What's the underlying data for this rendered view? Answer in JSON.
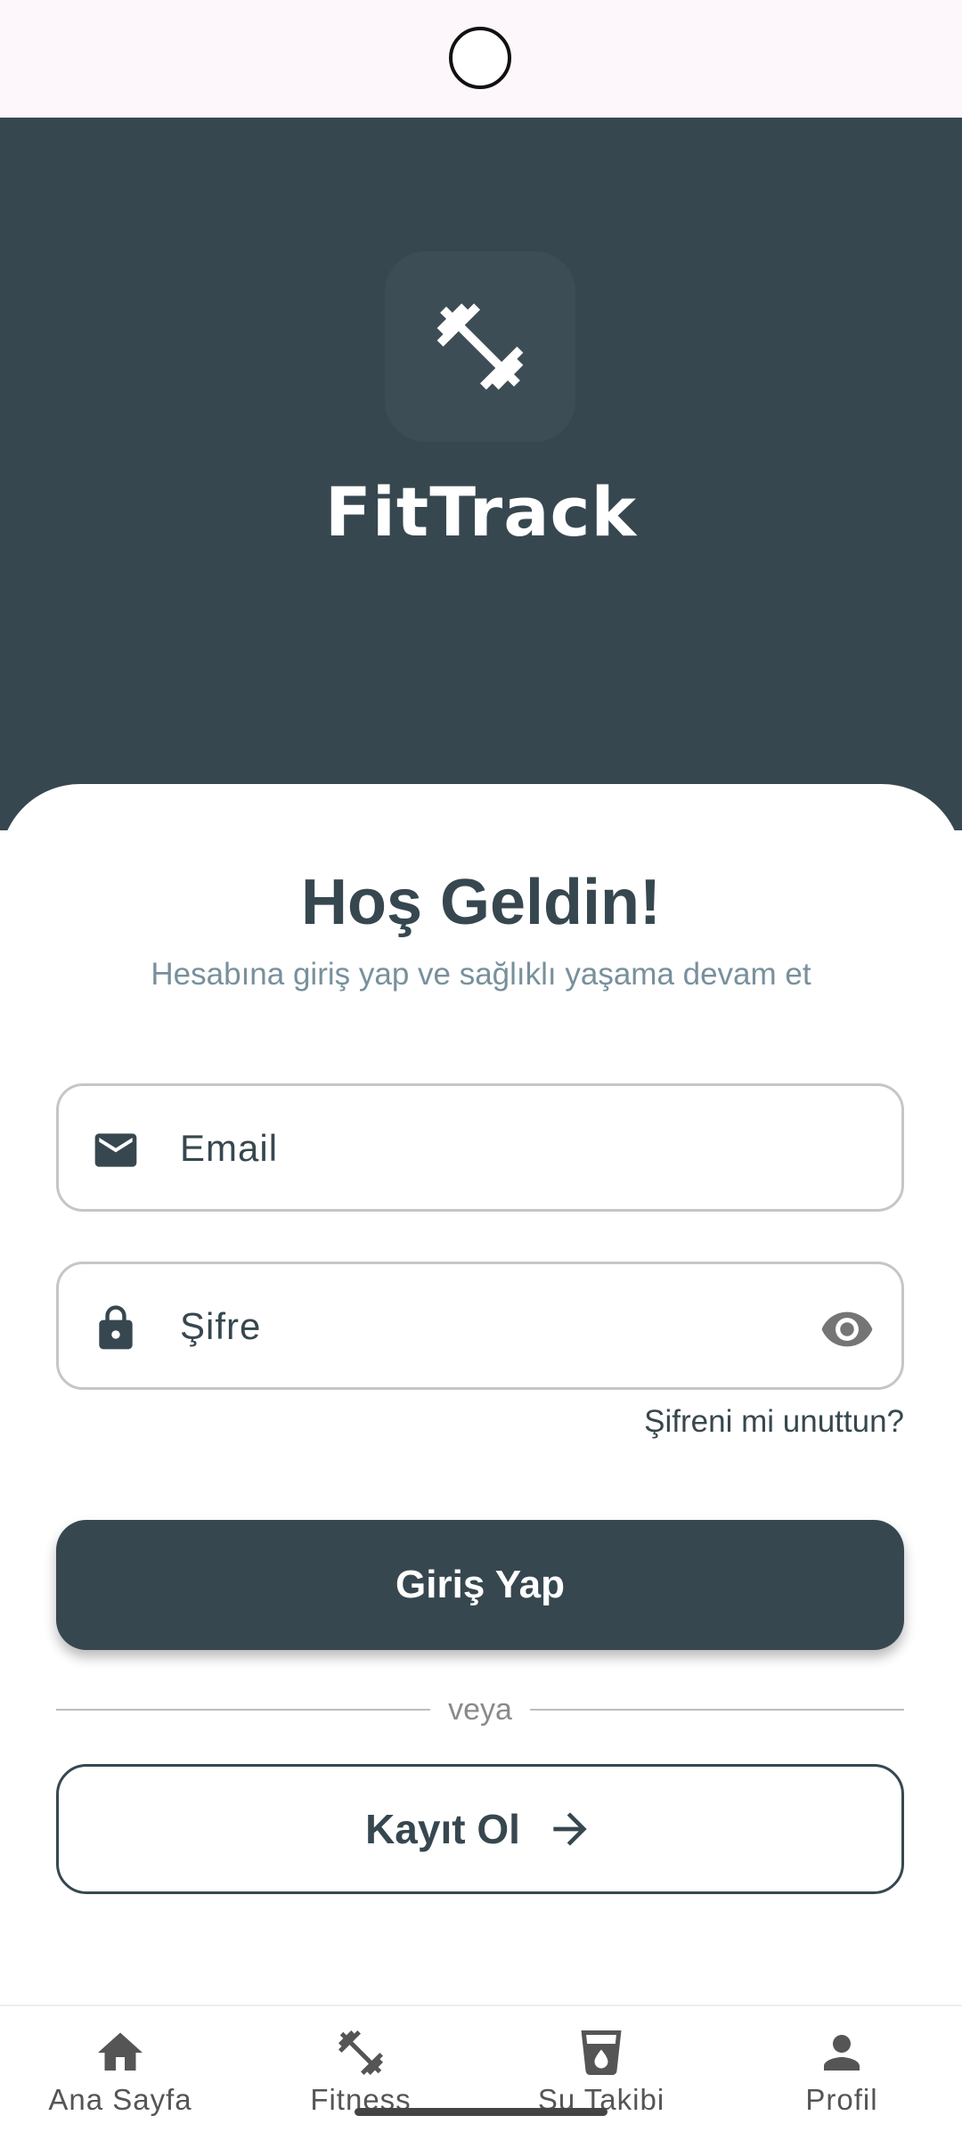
{
  "app": {
    "name": "FitTrack"
  },
  "welcome": {
    "title": "Hoş Geldin!",
    "subtitle": "Hesabına giriş yap ve sağlıklı yaşama devam et"
  },
  "form": {
    "email_placeholder": "Email",
    "password_placeholder": "Şifre",
    "forgot_label": "Şifreni mi unuttun?",
    "login_label": "Giriş Yap",
    "divider_label": "veya",
    "register_label": "Kayıt Ol"
  },
  "nav": {
    "items": [
      {
        "label": "Ana Sayfa",
        "icon": "home-icon"
      },
      {
        "label": "Fitness",
        "icon": "dumbbell-icon"
      },
      {
        "label": "Su Takibi",
        "icon": "water-glass-icon"
      },
      {
        "label": "Profil",
        "icon": "person-icon"
      }
    ]
  },
  "colors": {
    "primary": "#37474f",
    "subtitle": "#78909c",
    "background": "#ffffff"
  }
}
